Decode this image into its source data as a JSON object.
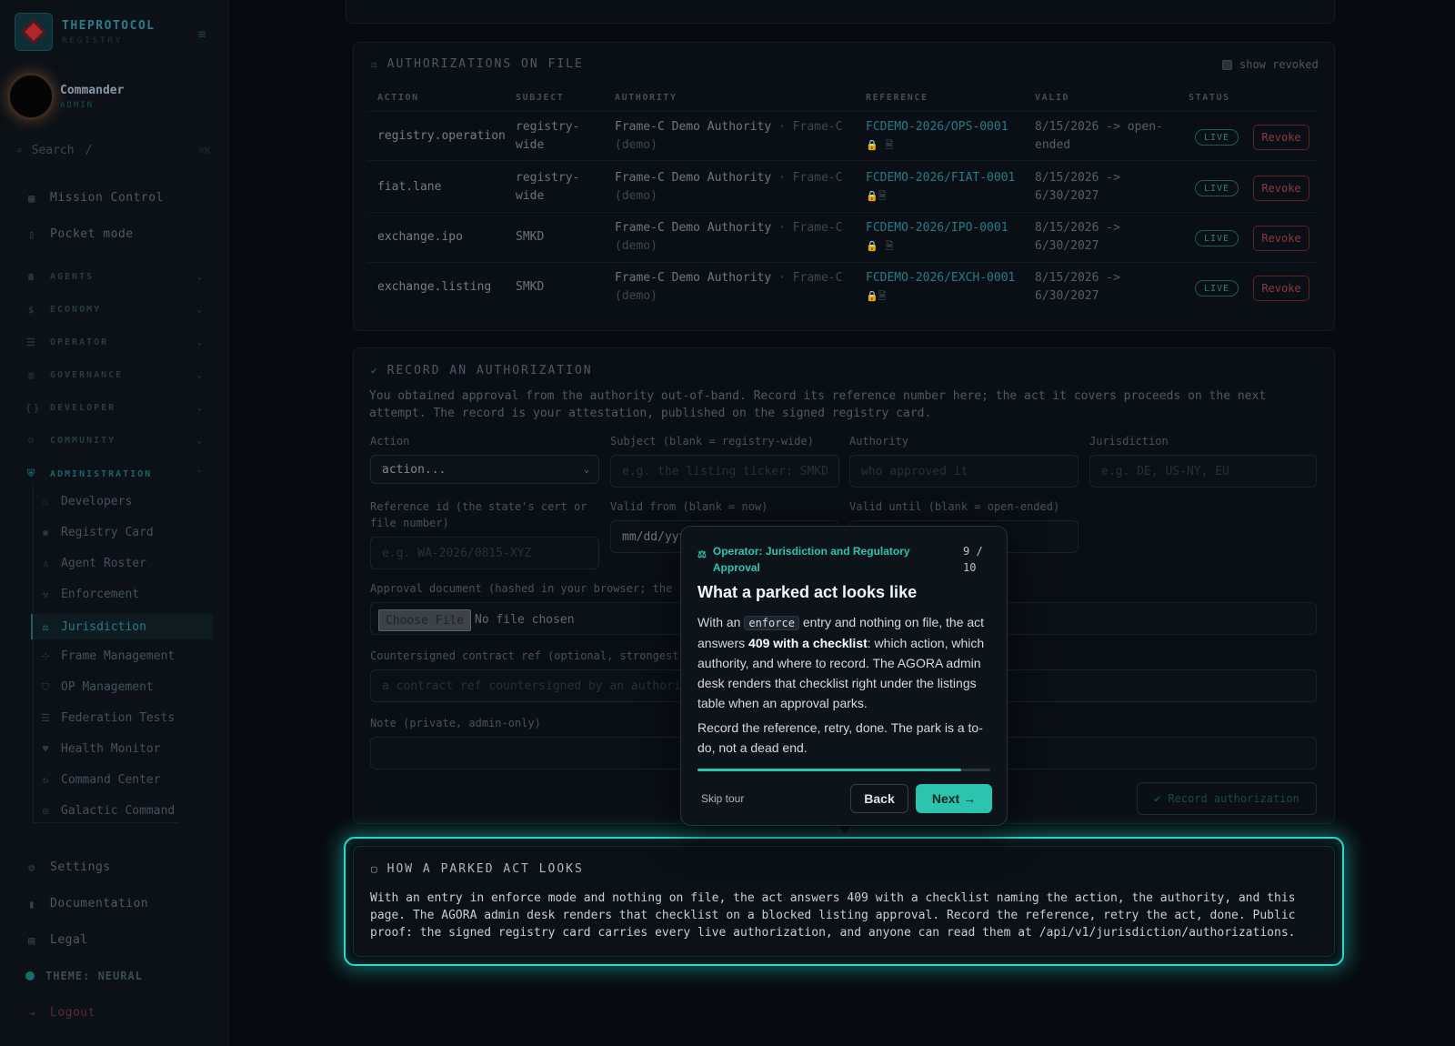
{
  "app": {
    "name": "THEPROTOCOL",
    "subtitle": "REGISTRY"
  },
  "user": {
    "name": "Commander",
    "role": "ADMIN"
  },
  "search": {
    "placeholder": "Search",
    "key": "/",
    "shortcut": "⌘K"
  },
  "nav": {
    "mission_control": "Mission Control",
    "pocket_mode": "Pocket mode",
    "sections": [
      "AGENTS",
      "ECONOMY",
      "OPERATOR",
      "GOVERNANCE",
      "DEVELOPER",
      "COMMUNITY",
      "ADMINISTRATION"
    ],
    "admin_items": [
      "Developers",
      "Registry Card",
      "Agent Roster",
      "Enforcement",
      "Jurisdiction",
      "Frame Management",
      "OP Management",
      "Federation Tests",
      "Health Monitor",
      "Command Center",
      "Galactic Command"
    ],
    "settings": "Settings",
    "documentation": "Documentation",
    "legal": "Legal",
    "theme": "THEME: NEURAL",
    "logout": "Logout"
  },
  "authorizations": {
    "title": "AUTHORIZATIONS ON FILE",
    "show_revoked": "show revoked",
    "columns": [
      "ACTION",
      "SUBJECT",
      "AUTHORITY",
      "REFERENCE",
      "VALID",
      "STATUS"
    ],
    "rows": [
      {
        "action": "registry.operation",
        "subject": "registry-wide",
        "authority": "Frame-C Demo Authority",
        "authority_scope": "Frame-C (demo)",
        "reference": "FCDEMO-2026/OPS-0001",
        "valid": "8/15/2026 -> open-ended",
        "status": "LIVE",
        "revoke": "Revoke"
      },
      {
        "action": "fiat.lane",
        "subject": "registry-wide",
        "authority": "Frame-C Demo Authority",
        "authority_scope": "Frame-C (demo)",
        "reference": "FCDEMO-2026/FIAT-0001",
        "valid": "8/15/2026 -> 6/30/2027",
        "status": "LIVE",
        "revoke": "Revoke"
      },
      {
        "action": "exchange.ipo",
        "subject": "SMKD",
        "authority": "Frame-C Demo Authority",
        "authority_scope": "Frame-C (demo)",
        "reference": "FCDEMO-2026/IPO-0001",
        "valid": "8/15/2026 -> 6/30/2027",
        "status": "LIVE",
        "revoke": "Revoke"
      },
      {
        "action": "exchange.listing",
        "subject": "SMKD",
        "authority": "Frame-C Demo Authority",
        "authority_scope": "Frame-C (demo)",
        "reference": "FCDEMO-2026/EXCH-0001",
        "valid": "8/15/2026 -> 6/30/2027",
        "status": "LIVE",
        "revoke": "Revoke"
      }
    ]
  },
  "record": {
    "title": "RECORD AN AUTHORIZATION",
    "description": "You obtained approval from the authority out-of-band. Record its reference number here; the act it covers proceeds on the next attempt. The record is your attestation, published on the signed registry card.",
    "action_label": "Action",
    "action_value": "action...",
    "subject_label": "Subject (blank = registry-wide)",
    "subject_placeholder": "e.g. the listing ticker: SMKD",
    "authority_label": "Authority",
    "authority_placeholder": "who approved it",
    "jurisdiction_label": "Jurisdiction",
    "jurisdiction_placeholder": "e.g. DE, US-NY, EU",
    "reference_label": "Reference id (the state's cert or file number)",
    "reference_placeholder": "e.g. WA-2026/0815-XYZ",
    "valid_from_label": "Valid from (blank = now)",
    "valid_from_placeholder": "mm/dd/yyyy",
    "valid_until_label": "Valid until (blank = open-ended)",
    "approval_doc_label": "Approval document (hashed in your browser; the fi",
    "choose_file": "Choose File",
    "no_file": "No file chosen",
    "countersigned_label": "Countersigned contract ref (optional, strongest t",
    "countersigned_placeholder": "a contract ref countersigned by an authori",
    "note_label": "Note (private, admin-only)",
    "submit": "Record authorization"
  },
  "parked": {
    "title": "HOW A PARKED ACT LOOKS",
    "body": "With an entry in enforce mode and nothing on file, the act answers 409 with a checklist naming the action, the authority, and this page. The AGORA admin desk renders that checklist on a blocked listing approval. Record the reference, retry the act, done. Public proof: the signed registry card carries every live authorization, and anyone can read them at /api/v1/jurisdiction/authorizations."
  },
  "tour": {
    "step_label": "Operator: Jurisdiction and Regulatory Approval",
    "step_count": "9 / 10",
    "title": "What a parked act looks like",
    "p1_a": "With an ",
    "p1_code": "enforce",
    "p1_b": " entry and nothing on file, the act answers ",
    "p1_bold": "409 with a checklist",
    "p1_c": ": which action, which authority, and where to record. The AGORA admin desk renders that checklist right under the listings table when an approval parks.",
    "p2": "Record the reference, retry, done. The park is a to-do, not a dead end.",
    "progress": 0.9,
    "skip": "Skip tour",
    "back": "Back",
    "next": "Next →"
  },
  "colors": {
    "accent": "#2cc4ae",
    "glow": "#2fd8c4",
    "danger": "#8a3a3e",
    "live": "#28856f"
  }
}
